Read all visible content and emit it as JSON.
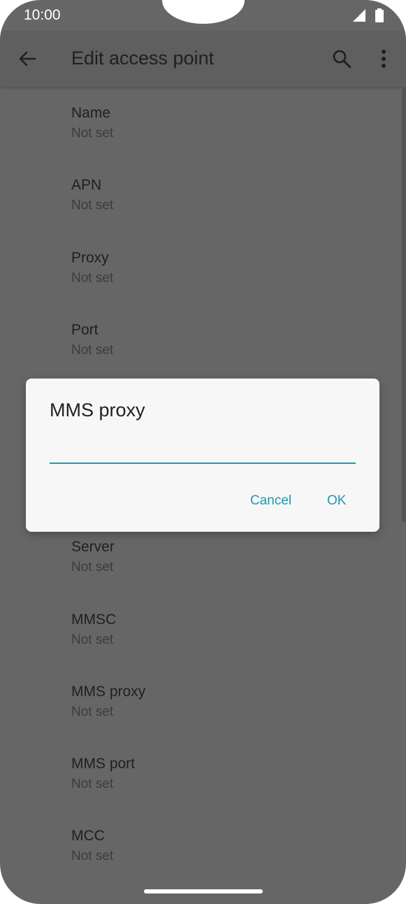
{
  "status": {
    "time": "10:00"
  },
  "appbar": {
    "title": "Edit access point"
  },
  "list": [
    {
      "title": "Name",
      "value": "Not set"
    },
    {
      "title": "APN",
      "value": "Not set"
    },
    {
      "title": "Proxy",
      "value": "Not set"
    },
    {
      "title": "Port",
      "value": "Not set"
    },
    {
      "title": "Server",
      "value": "Not set"
    },
    {
      "title": "MMSC",
      "value": "Not set"
    },
    {
      "title": "MMS proxy",
      "value": "Not set"
    },
    {
      "title": "MMS port",
      "value": "Not set"
    },
    {
      "title": "MCC",
      "value": "Not set"
    }
  ],
  "dialog": {
    "title": "MMS proxy",
    "value": "",
    "cancel_label": "Cancel",
    "ok_label": "OK"
  },
  "colors": {
    "accent": "#1a9bb0",
    "scrim": "#666666"
  }
}
